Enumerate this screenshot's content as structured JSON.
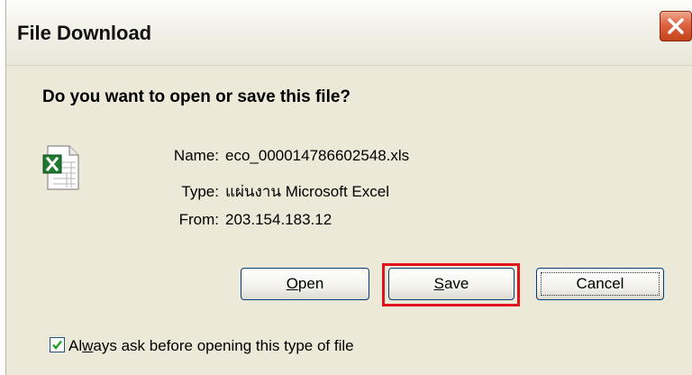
{
  "dialog": {
    "title": "File Download",
    "question": "Do you want to open or save this file?",
    "file": {
      "icon": "excel-file-icon",
      "name_label": "Name:",
      "name_value": "eco_000014786602548.xls",
      "type_label": "Type:",
      "type_value": "แผ่นงาน Microsoft Excel",
      "from_label": "From:",
      "from_value": "203.154.183.12"
    },
    "buttons": {
      "open_accel": "O",
      "open_rest": "pen",
      "save_accel": "S",
      "save_rest": "ave",
      "cancel_label": "Cancel"
    },
    "checkbox": {
      "label_pre": "Al",
      "label_accel": "w",
      "label_post": "ays ask before opening this type of file",
      "checked": true
    },
    "colors": {
      "dialog_bg": "#ece9d8",
      "close_button": "#c4411d",
      "highlight": "#e0131c",
      "button_border": "#003c74"
    }
  }
}
